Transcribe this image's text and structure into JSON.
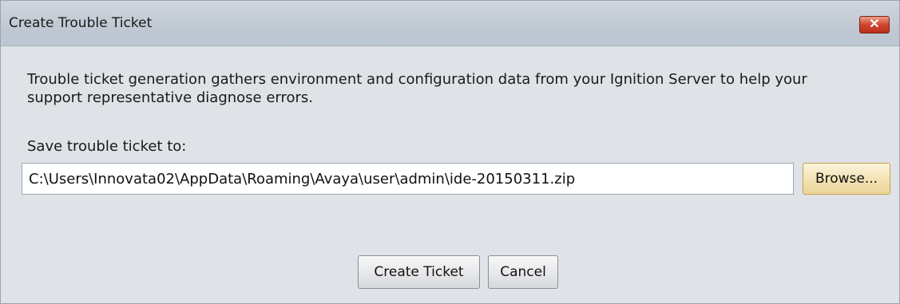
{
  "window": {
    "title": "Create Trouble Ticket",
    "close_icon": "close-icon",
    "close_glyph": "✕"
  },
  "body": {
    "description": "Trouble ticket generation gathers environment and configuration data from your Ignition Server to help your support representative diagnose errors.",
    "save_label": "Save trouble ticket to:",
    "path_value": "C:\\Users\\Innovata02\\AppData\\Roaming\\Avaya\\user\\admin\\ide-20150311.zip",
    "browse_label": "Browse..."
  },
  "footer": {
    "create_label": "Create Ticket",
    "cancel_label": "Cancel"
  },
  "colors": {
    "close_button": "#d1452f",
    "titlebar": "#c4ccd6",
    "content": "#dfe2e6",
    "browse_highlight": "#f4e3b6"
  }
}
